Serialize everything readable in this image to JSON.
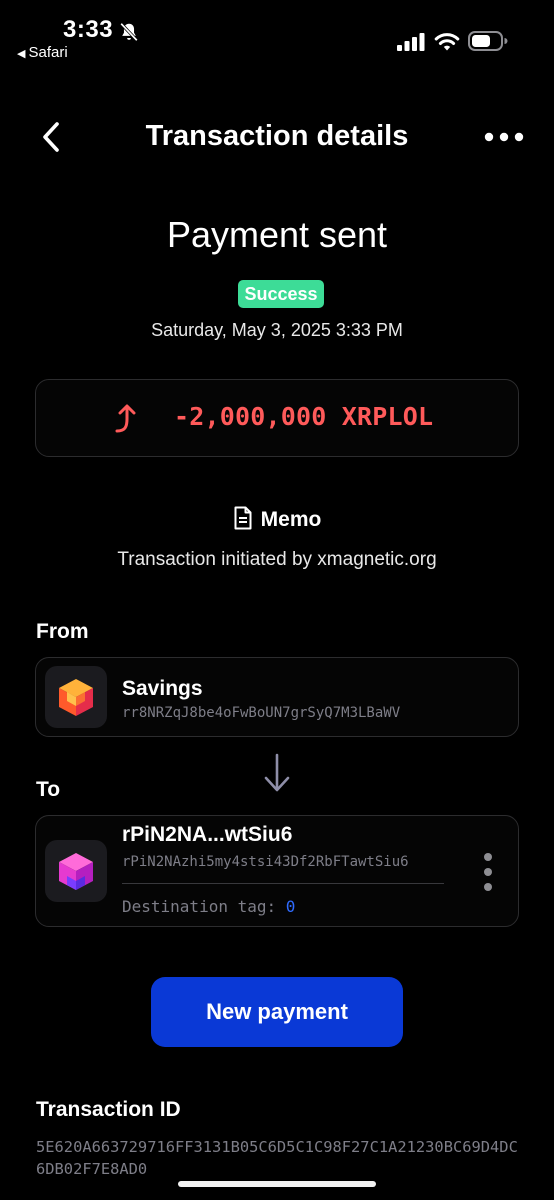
{
  "status_bar": {
    "time": "3:33",
    "back_app": "Safari",
    "icons": [
      "bell-slash-icon",
      "cellular-signal-icon",
      "wifi-icon",
      "battery-icon"
    ]
  },
  "nav": {
    "title": "Transaction details",
    "back_icon": "chevron-left-icon",
    "more_icon": "more-horizontal-icon"
  },
  "header": {
    "title": "Payment sent",
    "status": "Success",
    "date": "Saturday, May 3, 2025 3:33 PM"
  },
  "amount": {
    "value": "-2,000,000 XRPLOL",
    "icon": "outgoing-arrow-icon"
  },
  "memo": {
    "title": "Memo",
    "text": "Transaction initiated by xmagnetic.org"
  },
  "from": {
    "label": "From",
    "name": "Savings",
    "address": "rr8NRZqJ8be4oFwBoUN7grSyQ7M3LBaWV"
  },
  "to": {
    "label": "To",
    "name": "rPiN2NA...wtSiu6",
    "address": "rPiN2NAzhi5my4stsi43Df2RbFTawtSiu6",
    "destination_tag_label": "Destination tag:",
    "destination_tag_value": "0"
  },
  "actions": {
    "new_payment": "New payment"
  },
  "transaction": {
    "id_label": "Transaction ID",
    "id": "5E620A663729716FF3131B05C6D5C1C98F27C1A21230BC69D4DC6DB02F7E8AD0"
  },
  "colors": {
    "background": "#000000",
    "success": "#3ddc97",
    "amount_negative": "#ff5a5a",
    "primary_button": "#0a39d6",
    "muted_text": "#7e7e88",
    "tag_value": "#2f6bff"
  }
}
